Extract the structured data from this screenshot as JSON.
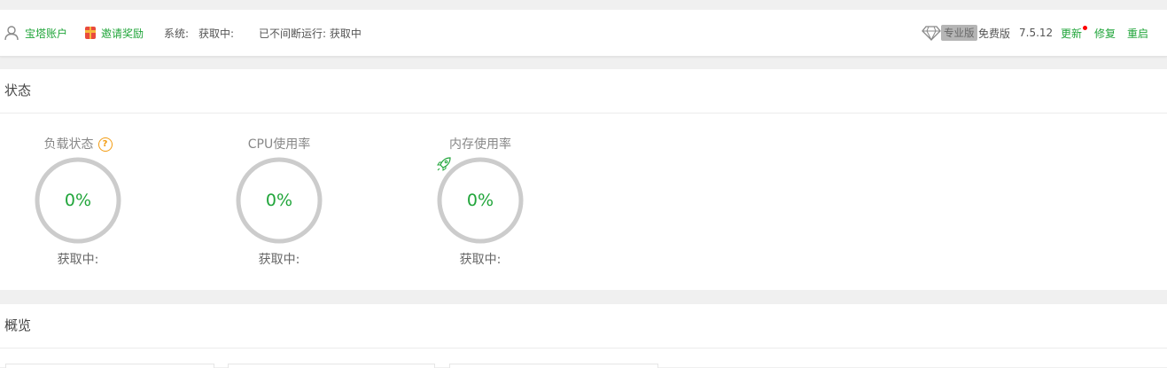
{
  "topbar": {
    "account_label": "宝塔账户",
    "invite_label": "邀请奖励",
    "system_label": "系统:",
    "system_value": "获取中:",
    "uptime_label": "已不间断运行: 获取中",
    "pro_label": "专业版",
    "free_label": "免费版",
    "version": "7.5.12",
    "update_label": "更新",
    "repair_label": "修复",
    "restart_label": "重启"
  },
  "status": {
    "title": "状态",
    "gauges": [
      {
        "title": "负载状态",
        "value": "0%",
        "sub": "获取中:"
      },
      {
        "title": "CPU使用率",
        "value": "0%",
        "sub": "获取中:"
      },
      {
        "title": "内存使用率",
        "value": "0%",
        "sub": "获取中:"
      }
    ]
  },
  "overview": {
    "title": "概览"
  },
  "colors": {
    "accent": "#20a53a",
    "ring": "#cccccc",
    "help": "#f39c12",
    "badge": "#b5b5b5"
  }
}
